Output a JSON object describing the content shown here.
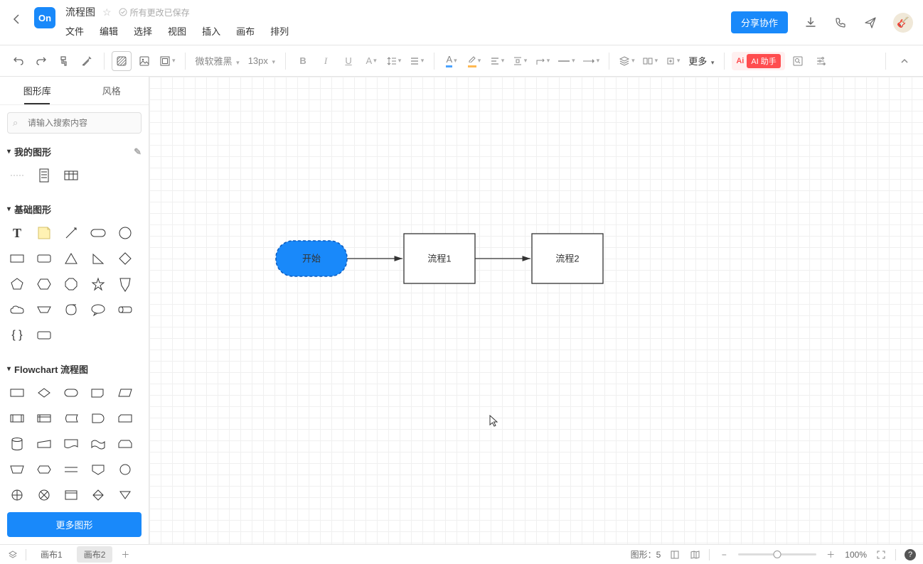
{
  "header": {
    "logo": "On",
    "title": "流程图",
    "save_status": "所有更改已保存",
    "menus": [
      "文件",
      "编辑",
      "选择",
      "视图",
      "插入",
      "画布",
      "排列"
    ],
    "share_label": "分享协作"
  },
  "toolbar": {
    "font_family": "微软雅黑",
    "font_size": "13px",
    "more_label": "更多",
    "ai_label": "AI 助手",
    "ai_icon_text": "Ai"
  },
  "sidebar": {
    "tabs": {
      "shapes": "图形库",
      "styles": "风格"
    },
    "search_placeholder": "请输入搜索内容",
    "sections": {
      "my_shapes": "我的图形",
      "basic": "基础图形",
      "flowchart": "Flowchart 流程图"
    },
    "more_shapes": "更多图形"
  },
  "canvas": {
    "nodes": {
      "start": {
        "label": "开始"
      },
      "proc1": {
        "label": "流程1"
      },
      "proc2": {
        "label": "流程2"
      }
    }
  },
  "statusbar": {
    "pages": [
      "画布1",
      "画布2"
    ],
    "active_page": 1,
    "shape_count_label": "图形：",
    "shape_count": "5",
    "zoom": "100%"
  }
}
